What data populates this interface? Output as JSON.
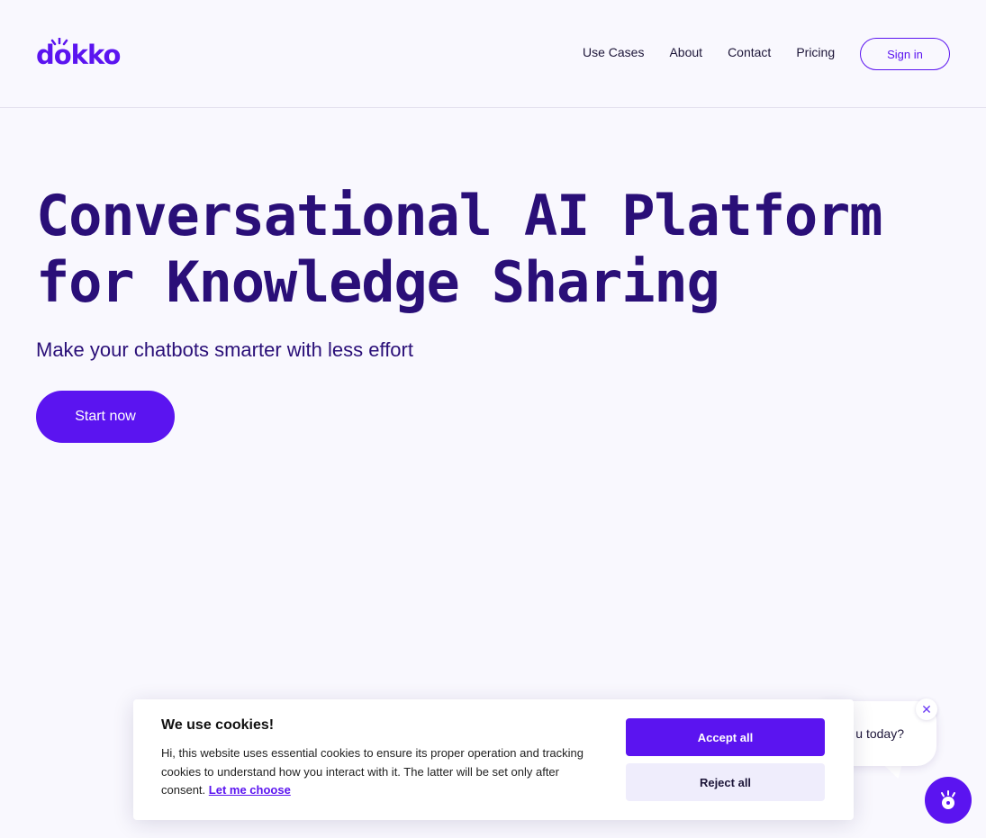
{
  "brand": {
    "logo_text": "dokko",
    "accent": "#5b14f0",
    "title_color": "#2a0f78"
  },
  "header": {
    "nav": [
      "Use Cases",
      "About",
      "Contact",
      "Pricing"
    ],
    "signin_label": "Sign in"
  },
  "hero": {
    "title": "Conversational AI Platform for Knowledge Sharing",
    "subtitle": "Make your chatbots smarter with less effort",
    "cta_label": "Start now"
  },
  "chat": {
    "bubble_text": "u today?",
    "close_icon": "close-icon",
    "launcher_icon": "dokko-bot-icon"
  },
  "cookie": {
    "title": "We use cookies!",
    "text": "Hi, this website uses essential cookies to ensure its proper operation and tracking cookies to understand how you interact with it. The latter will be set only after consent.",
    "link_label": "Let me choose",
    "accept_label": "Accept all",
    "reject_label": "Reject all"
  }
}
